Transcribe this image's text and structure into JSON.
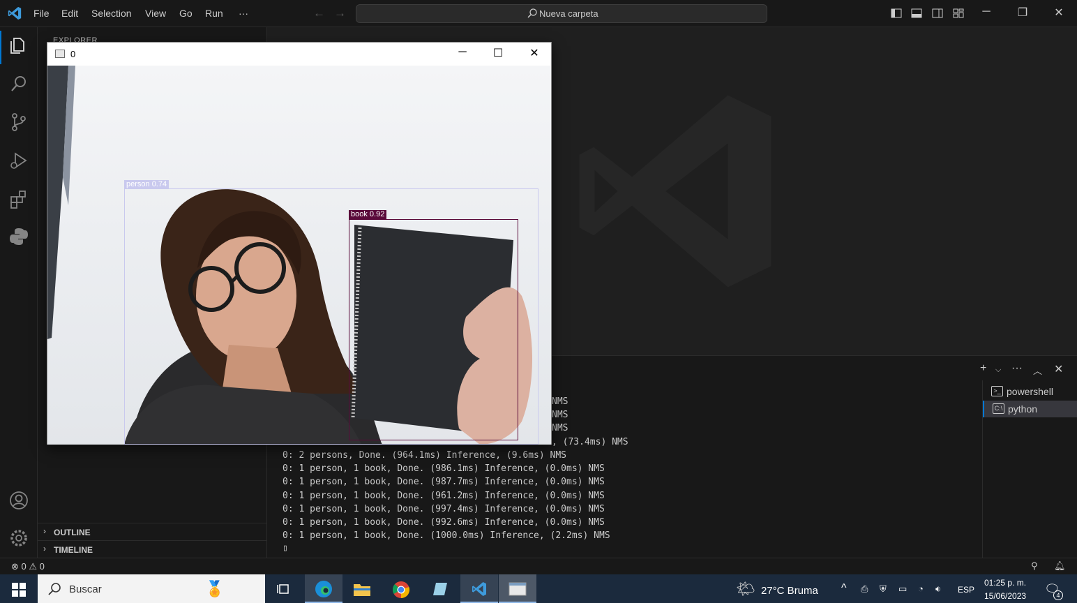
{
  "titlebar": {
    "menu": [
      "File",
      "Edit",
      "Selection",
      "View",
      "Go",
      "Run",
      "···"
    ],
    "command_center": "Nueva carpeta",
    "colors": {
      "accent": "#0078d4"
    }
  },
  "sidebar": {
    "explorer_title": "EXPLORER",
    "sections": [
      {
        "label": "OUTLINE"
      },
      {
        "label": "TIMELINE"
      }
    ]
  },
  "cv_window": {
    "title": "0",
    "detections": [
      {
        "label": "person 0.74",
        "color": "#c9c9ee"
      },
      {
        "label": "book 0.92",
        "color": "#5a0a3a"
      }
    ]
  },
  "terminal": {
    "lines": [
      "0: 1 person, 1 book, Done. (961.2ms) Inference, (0.0ms) NMS",
      "0: 1 person, 1 book, Done. (997.4ms) Inference, (0.0ms) NMS",
      "0: 1 person, 1 book, Done. (992.6ms) Inference, (0.0ms) NMS",
      "0: 1 person, 1 book, Done. (1000.0ms) Inference, (2.2ms) NMS"
    ],
    "partial_lines": [
      "NMS",
      "NMS",
      "NMS",
      ", (73.4ms) NMS"
    ],
    "lines_mid": [
      "0: 2 persons, Done. (964.1ms) Inference, (9.6ms) NMS",
      "0: 1 person, 1 book, Done. (986.1ms) Inference, (0.0ms) NMS",
      "0: 1 person, 1 book, Done. (987.7ms) Inference, (0.0ms) NMS"
    ],
    "cursor": "▯",
    "sessions": [
      {
        "label": "powershell",
        "selected": false
      },
      {
        "label": "python",
        "selected": true
      }
    ]
  },
  "statusbar": {
    "errors": "0",
    "warnings": "0"
  },
  "taskbar": {
    "search_placeholder": "Buscar",
    "weather": "27°C  Bruma",
    "language": "ESP",
    "time": "01:25 p. m.",
    "date": "15/06/2023",
    "notifications": "4"
  }
}
